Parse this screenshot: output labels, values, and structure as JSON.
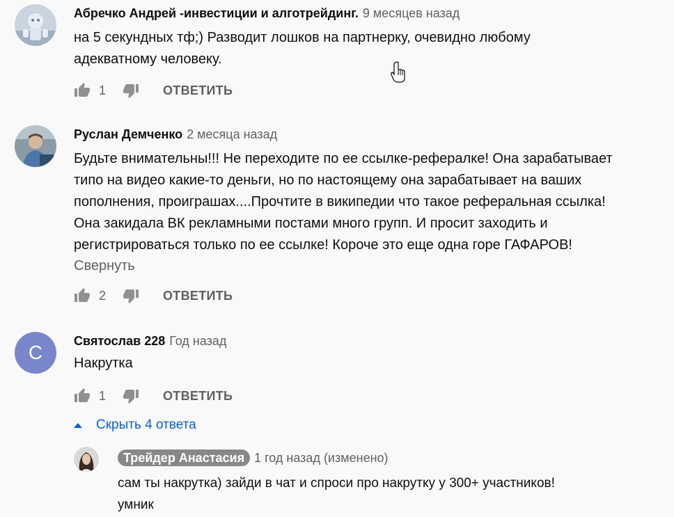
{
  "comments": [
    {
      "author": "Абречко Андрей -инвестиции и алготрейдинг.",
      "time": "9 месяцев назад",
      "lines": [
        "на 5 секундных тф;) Разводит лошков на партнерку, очевидно любому",
        "адекватному человеку."
      ],
      "likes": "1",
      "reply_label": "ОТВЕТИТЬ"
    },
    {
      "author": "Руслан Демченко",
      "time": "2 месяца назад",
      "lines": [
        "Будьте внимательны!!! Не переходите по ее ссылке-рефералке! Она зарабатывает",
        "типо на видео какие-то деньги, но по настоящему она зарабатывает на ваших",
        "пополнения, проиграшах....Прочтите в википедии что такое реферальная ссылка!",
        "Она закидала ВК рекламными постами много групп. И просит заходить и",
        "регистрироваться только по ее ссылке! Короче это еще одна горе ГАФАРОВ!"
      ],
      "collapse_label": "Свернуть",
      "likes": "2",
      "reply_label": "ОТВЕТИТЬ"
    },
    {
      "author": "Святослав 228",
      "time": "Год назад",
      "avatar_letter": "С",
      "avatar_color": "#7986cb",
      "lines": [
        "Накрутка"
      ],
      "likes": "1",
      "reply_label": "ОТВЕТИТЬ",
      "hide_replies_label": "Скрыть 4 ответа"
    }
  ],
  "reply": {
    "author": "Трейдер Анастасия",
    "time": "1 год назад (изменено)",
    "lines": [
      "сам ты накрутка) зайди в чат и спроси про накрутку у 300+ участников!",
      "умник"
    ]
  },
  "colors": {
    "background": "#f9f9f9",
    "link_blue": "#065fd4",
    "secondary_text": "#606060"
  }
}
